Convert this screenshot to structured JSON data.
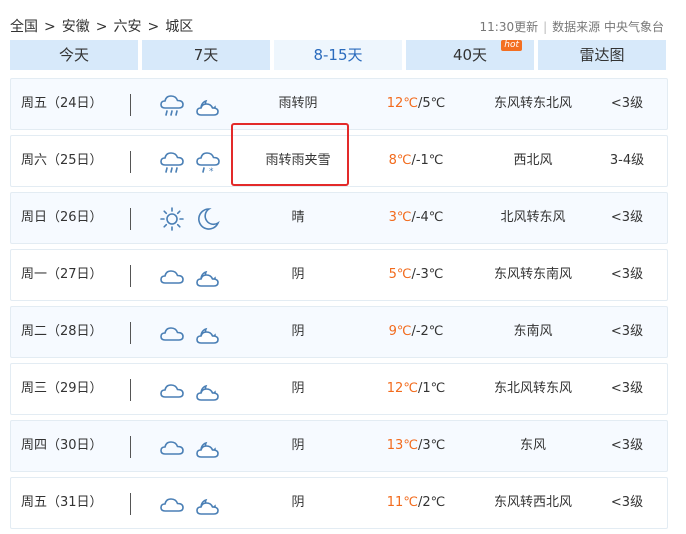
{
  "breadcrumb": [
    "全国",
    "安徽",
    "六安",
    "城区"
  ],
  "update_time": "11:30更新",
  "data_source": "数据来源 中央气象台",
  "tabs": [
    {
      "label": "今天",
      "active": false
    },
    {
      "label": "7天",
      "active": false
    },
    {
      "label": "8-15天",
      "active": true
    },
    {
      "label": "40天",
      "active": false,
      "badge": "hot"
    },
    {
      "label": "雷达图",
      "active": false
    }
  ],
  "colors": {
    "accent": "#2a6bbd",
    "high_temp": "#f26b1d",
    "tab_bg": "#d7e9fa",
    "highlight": "#e32a2a"
  },
  "forecast": [
    {
      "day": "周五（24日）",
      "icons": [
        "cloud-rain-icon",
        "partly-cloudy-night-icon"
      ],
      "weather": "雨转阴",
      "high": "12℃",
      "low": "/5℃",
      "wind": "东风转东北风",
      "level": "<3级"
    },
    {
      "day": "周六（25日）",
      "icons": [
        "cloud-rain-icon",
        "cloud-sleet-icon"
      ],
      "weather": "雨转雨夹雪",
      "high": "8℃",
      "low": "/-1℃",
      "wind": "西北风",
      "level": "3-4级"
    },
    {
      "day": "周日（26日）",
      "icons": [
        "sun-icon",
        "moon-icon"
      ],
      "weather": "晴",
      "high": "3℃",
      "low": "/-4℃",
      "wind": "北风转东风",
      "level": "<3级"
    },
    {
      "day": "周一（27日）",
      "icons": [
        "cloud-icon",
        "partly-cloudy-night-icon"
      ],
      "weather": "阴",
      "high": "5℃",
      "low": "/-3℃",
      "wind": "东风转东南风",
      "level": "<3级"
    },
    {
      "day": "周二（28日）",
      "icons": [
        "cloud-icon",
        "partly-cloudy-night-icon"
      ],
      "weather": "阴",
      "high": "9℃",
      "low": "/-2℃",
      "wind": "东南风",
      "level": "<3级"
    },
    {
      "day": "周三（29日）",
      "icons": [
        "cloud-icon",
        "partly-cloudy-night-icon"
      ],
      "weather": "阴",
      "high": "12℃",
      "low": "/1℃",
      "wind": "东北风转东风",
      "level": "<3级"
    },
    {
      "day": "周四（30日）",
      "icons": [
        "cloud-icon",
        "partly-cloudy-night-icon"
      ],
      "weather": "阴",
      "high": "13℃",
      "low": "/3℃",
      "wind": "东风",
      "level": "<3级"
    },
    {
      "day": "周五（31日）",
      "icons": [
        "cloud-icon",
        "partly-cloudy-night-icon"
      ],
      "weather": "阴",
      "high": "11℃",
      "low": "/2℃",
      "wind": "东风转西北风",
      "level": "<3级"
    }
  ]
}
